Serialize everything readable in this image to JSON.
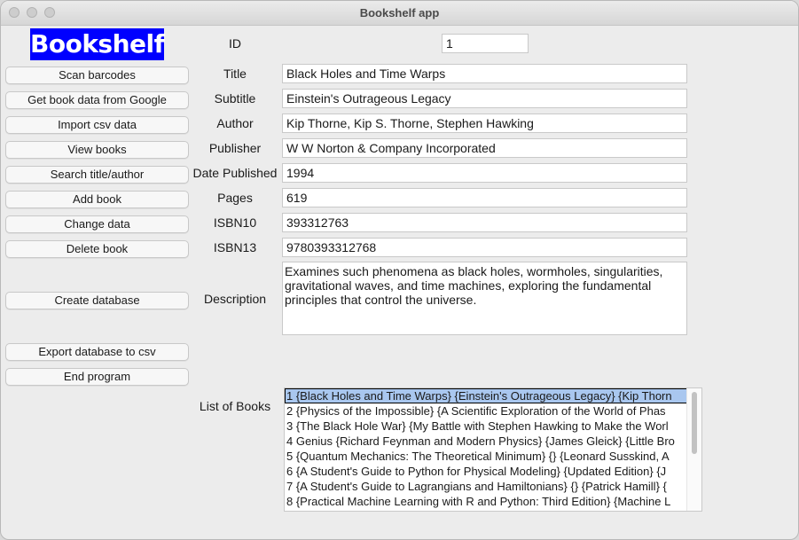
{
  "window": {
    "title": "Bookshelf app"
  },
  "app": {
    "logo_text": "Bookshelf"
  },
  "sidebar": {
    "buttons": [
      "Scan barcodes",
      "Get book data from Google",
      "Import csv data",
      "View books",
      "Search title/author",
      "Add book",
      "Change data",
      "Delete book",
      "Create database",
      "Export database to csv",
      "End program"
    ]
  },
  "form": {
    "id_label": "ID",
    "id_value": "1",
    "title_label": "Title",
    "title_value": "Black Holes and Time Warps",
    "subtitle_label": "Subtitle",
    "subtitle_value": "Einstein's Outrageous Legacy",
    "author_label": "Author",
    "author_value": "Kip Thorne, Kip S. Thorne, Stephen Hawking",
    "publisher_label": "Publisher",
    "publisher_value": "W W Norton & Company Incorporated",
    "date_label": "Date Published",
    "date_value": "1994",
    "pages_label": "Pages",
    "pages_value": "619",
    "isbn10_label": "ISBN10",
    "isbn10_value": "393312763",
    "isbn13_label": "ISBN13",
    "isbn13_value": "9780393312768",
    "description_label": "Description",
    "description_value": "Examines such phenomena as black holes, wormholes, singularities, gravitational waves, and time machines, exploring the fundamental principles that control the universe."
  },
  "books_list": {
    "label": "List of Books",
    "selected_index": 0,
    "items": [
      "1 {Black Holes and Time Warps} {Einstein's Outrageous Legacy} {Kip Thorn",
      "2 {Physics of the Impossible} {A Scientific Exploration of the World of Phas",
      "3 {The Black Hole War} {My Battle with Stephen Hawking to Make the Worl",
      "4 Genius {Richard Feynman and Modern Physics} {James Gleick} {Little Bro",
      "5 {Quantum Mechanics: The Theoretical Minimum} {} {Leonard Susskind, A",
      "6 {A Student's Guide to Python for Physical Modeling} {Updated Edition} {J",
      "7 {A Student's Guide to Lagrangians and Hamiltonians} {} {Patrick Hamill} {",
      "8 {Practical Machine Learning with R and Python: Third Edition} {Machine L"
    ]
  },
  "colors": {
    "logo_bg": "#0000ff",
    "logo_fg": "#ffffff",
    "selection": "#a9c7ef"
  }
}
